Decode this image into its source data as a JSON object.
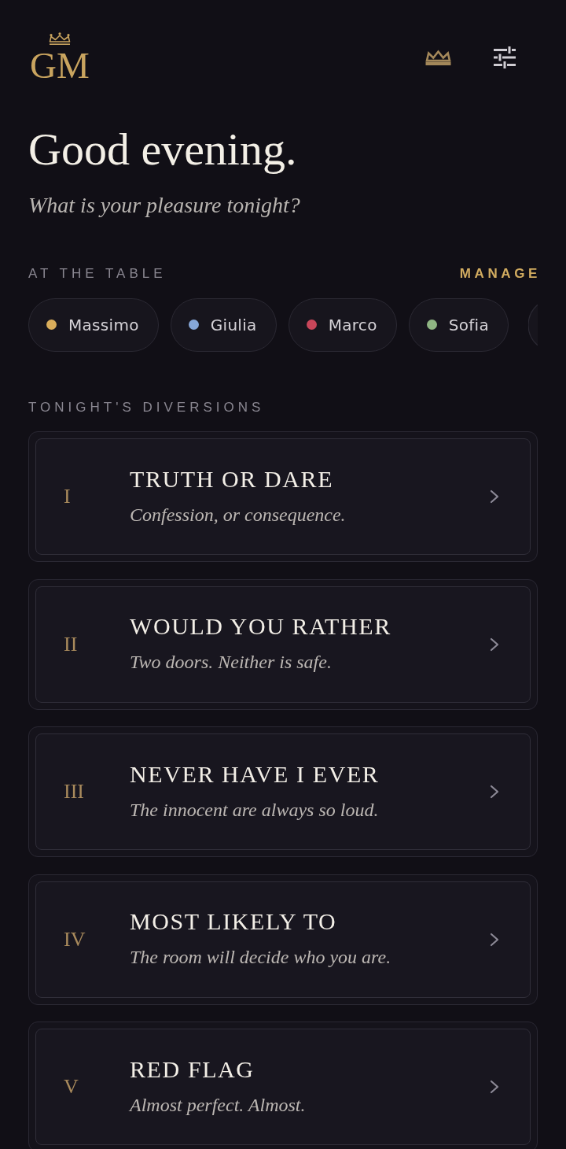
{
  "header": {
    "logo": "GM"
  },
  "greeting": {
    "title": "Good evening.",
    "subtitle": "What is your pleasure tonight?"
  },
  "players": {
    "label": "AT THE TABLE",
    "action": "MANAGE",
    "items": [
      {
        "name": "Massimo",
        "color": "#d9ad5b"
      },
      {
        "name": "Giulia",
        "color": "#86a7d8"
      },
      {
        "name": "Marco",
        "color": "#c8465a"
      },
      {
        "name": "Sofia",
        "color": "#8fb583"
      }
    ]
  },
  "games": {
    "label": "TONIGHT'S DIVERSIONS",
    "items": [
      {
        "numeral": "I",
        "title": "TRUTH OR DARE",
        "subtitle": "Confession, or consequence."
      },
      {
        "numeral": "II",
        "title": "WOULD YOU RATHER",
        "subtitle": "Two doors. Neither is safe."
      },
      {
        "numeral": "III",
        "title": "NEVER HAVE I EVER",
        "subtitle": "The innocent are always so loud."
      },
      {
        "numeral": "IV",
        "title": "MOST LIKELY TO",
        "subtitle": "The room will decide who you are."
      },
      {
        "numeral": "V",
        "title": "RED FLAG",
        "subtitle": "Almost perfect. Almost."
      }
    ]
  }
}
